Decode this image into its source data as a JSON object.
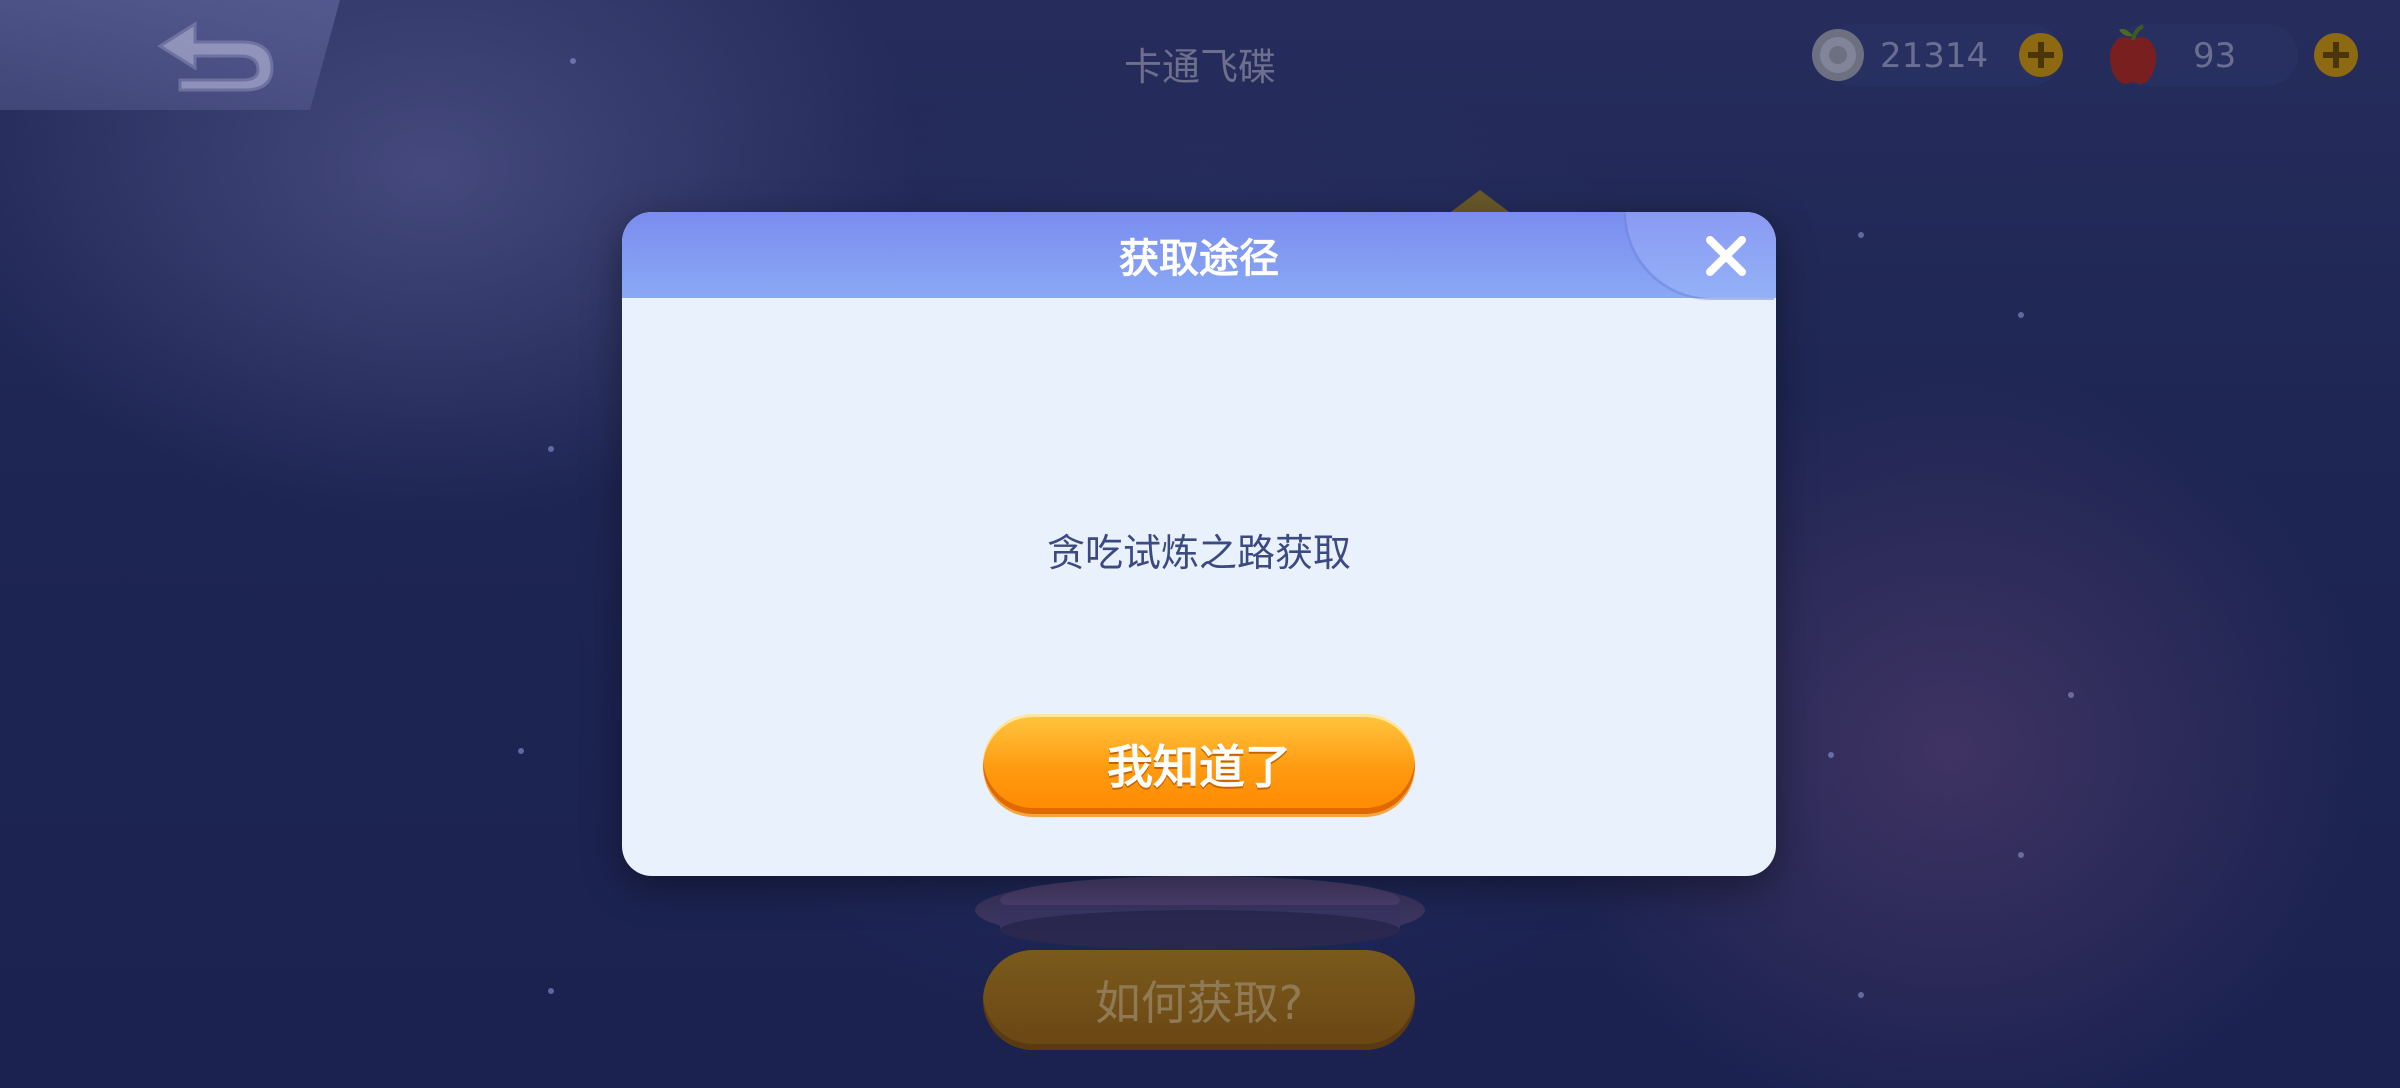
{
  "scene": {
    "title": "卡通飞碟",
    "coins": "21314",
    "apples": "93",
    "how_button_label": "如何获取?"
  },
  "dialog": {
    "title": "获取途径",
    "message": "贪吃试炼之路获取",
    "confirm_label": "我知道了"
  },
  "icons": {
    "back": "back-arrow-icon",
    "coin": "coin-icon",
    "apple": "apple-icon",
    "plus": "plus-icon",
    "close": "close-icon"
  },
  "colors": {
    "dialog_header": "#7a8cf0",
    "dialog_body": "#e9f1fc",
    "confirm_button": "#ff9a10",
    "background": "#1d2452"
  }
}
